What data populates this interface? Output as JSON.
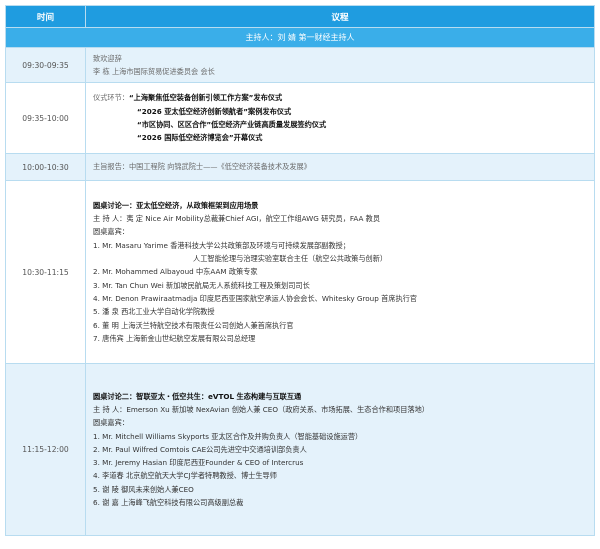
{
  "header": {
    "time": "时间",
    "agenda": "议程"
  },
  "host": "主持人：刘 婧 第一财经主持人",
  "rows": [
    {
      "time": "09:30-09:35",
      "lines": [
        "致欢迎辞",
        "李    栋  上海市国际贸易促进委员会 会长"
      ]
    },
    {
      "time": "09:35-10:00",
      "label": "仪式环节：",
      "items": [
        "“上海聚焦低空装备创新引领工作方案”发布仪式",
        "“2026 亚太低空经济创新领航者”案例发布仪式",
        "“市区协同、区区合作”低空经济产业链高质量发展签约仪式",
        "“2026 国际低空经济博览会”开幕仪式"
      ]
    },
    {
      "time": "10:00-10:30",
      "lines": [
        "主旨报告：中国工程院 向锦武院士——《低空经济装备技术及发展》"
      ]
    },
    {
      "time": "10:30-11:15",
      "title": "圆桌讨论一：亚太低空经济，从政策框架到应用场景",
      "moderator": "主 持 人：夷  定  Nice Air Mobility总裁兼Chief AGI，航空工作组AWG 研究员，FAA 教员",
      "guests_label": "圆桌嘉宾：",
      "guests": [
        "1. Mr. Masaru Yarime  香港科技大学公共政策部及环境与可持续发展部副教授；",
        "人工智能伦理与治理实验室联合主任（航空公共政策与创新）",
        "2. Mr. Mohammed Albayoud  中东AAM 政策专家",
        "3. Mr. Tan Chun Wei  新加坡民航局无人系统科技工程及策划司司长",
        "4. Mr. Denon Prawiraatmadja  印度尼西亚国家航空承运人协会会长、Whitesky Group 首席执行官",
        "5. 潘    泉  西北工业大学自动化学院教授",
        "6. 董    明  上海沃兰特航空技术有限责任公司创始人兼首席执行官",
        "7. 唐伟宾  上海新金山世纪航空发展有限公司总经理"
      ]
    },
    {
      "time": "11:15-12:00",
      "title": "圆桌讨论二：智联亚太・低空共生：eVTOL 生态构建与互联互通",
      "moderator": "主 持 人：Emerson Xu  新加坡 NexAvian 创始人兼 CEO（政府关系、市场拓展、生态合作和项目落地）",
      "guests_label": "圆桌嘉宾：",
      "guests": [
        "1. Mr. Mitchell Williams  Skyports 亚太区合作及并购负责人（智能基础设施运营）",
        "2. Mr. Paul Wilfred Comtois  CAE公司先进空中交通培训部负责人",
        "3. Mr. Jeremy Hasian  印度尼西亚Founder & CEO of Intercrus",
        "4. 李道春  北京航空航天大学CJ学者特聘教授、博士生导师",
        "5. 谢    陵  御风未来创始人兼CEO",
        "6. 谢    嘉  上海峰飞航空科技有限公司高级副总裁"
      ]
    }
  ]
}
